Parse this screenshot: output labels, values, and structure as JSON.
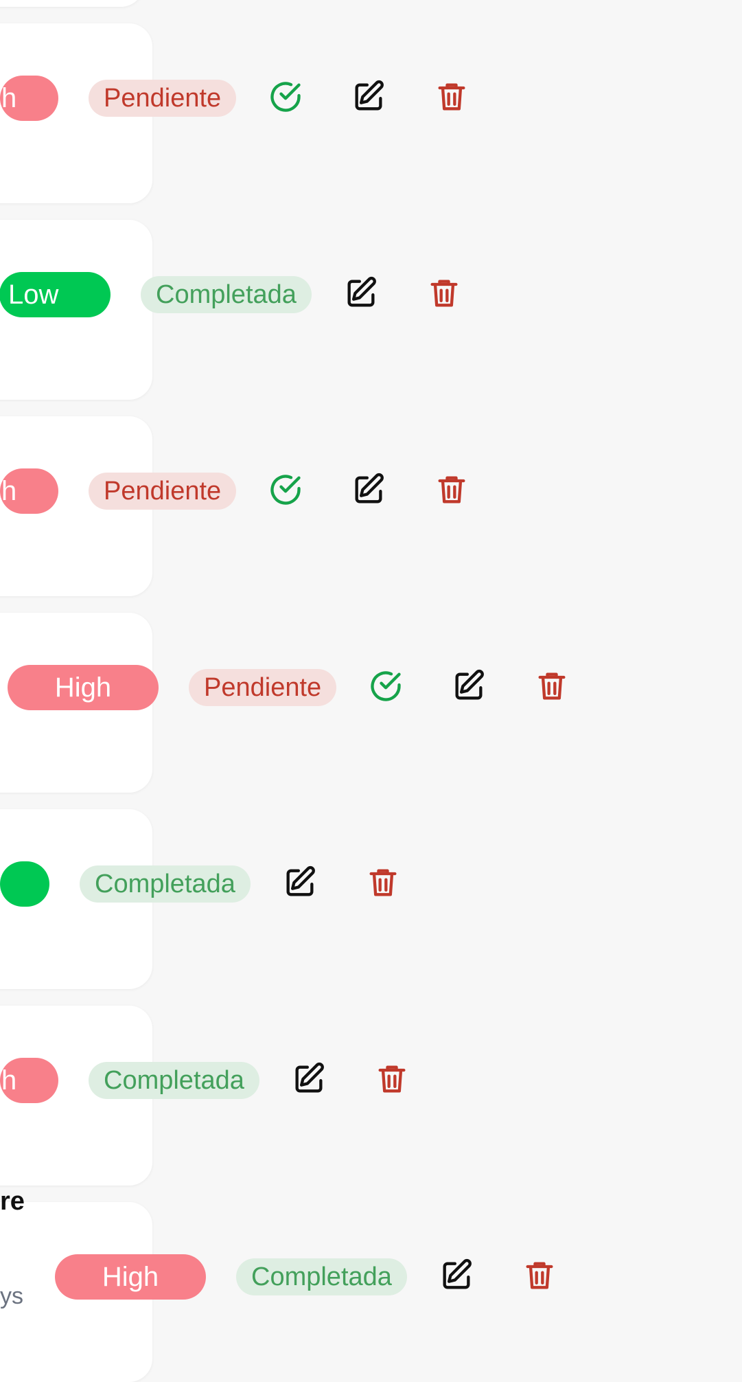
{
  "tasks": [
    {
      "priority": "h",
      "status": "Pendiente",
      "has_complete": true
    },
    {
      "priority": "Low",
      "status": "Completada",
      "has_complete": false
    },
    {
      "priority": "h",
      "status": "Pendiente",
      "has_complete": true
    },
    {
      "priority": "High",
      "status": "Pendiente",
      "has_complete": true
    },
    {
      "priority": "",
      "status": "Completada",
      "has_complete": false
    },
    {
      "priority": "h",
      "status": "Completada",
      "has_complete": false
    },
    {
      "priority": "High",
      "status": "Completada",
      "has_complete": false
    }
  ],
  "peek": {
    "title_fragment": "re",
    "subtitle_fragment": "ys"
  },
  "icons": {
    "complete": "check-circle-icon",
    "edit": "edit-icon",
    "delete": "trash-icon"
  },
  "colors": {
    "high": "#f8808a",
    "low": "#00c853",
    "pending_bg": "#f5dfdd",
    "pending_text": "#c0392b",
    "done_bg": "#deeee2",
    "done_text": "#43a05b",
    "complete_icon": "#16a34a",
    "delete_icon": "#c0392b"
  }
}
